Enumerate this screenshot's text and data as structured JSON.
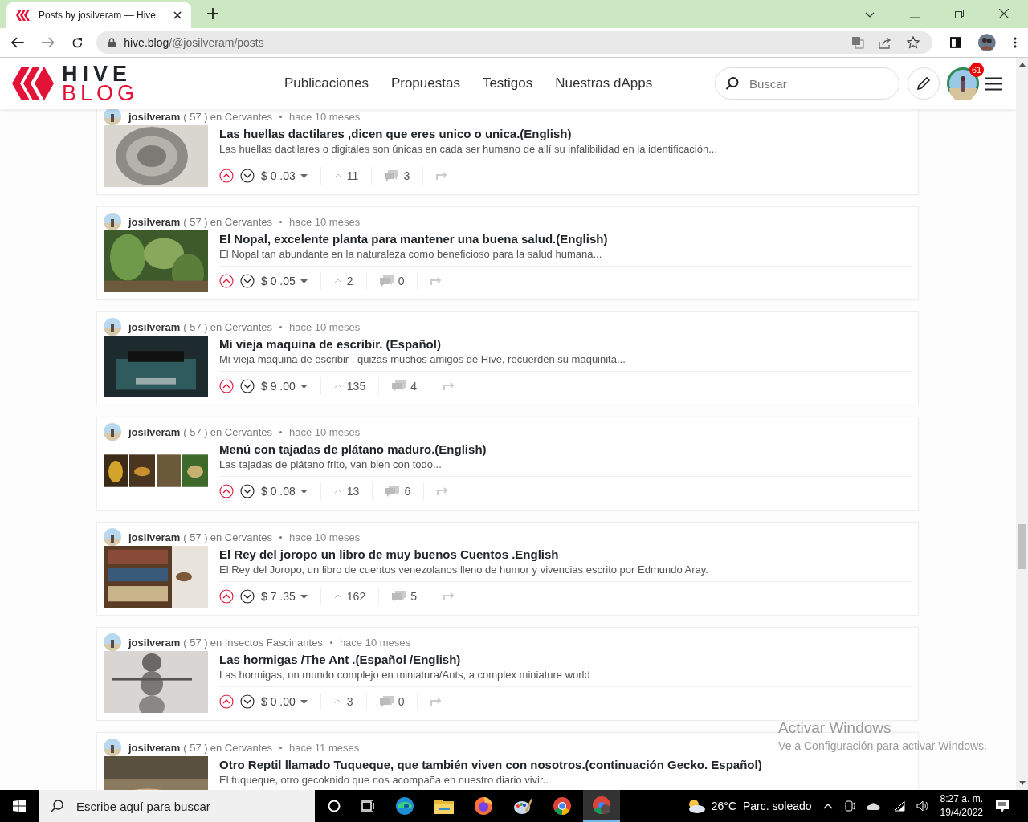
{
  "browser": {
    "tab_title": "Posts by josilveram — Hive",
    "url_host": "hive.blog",
    "url_path": "/@josilveram/posts"
  },
  "header": {
    "logo_top": "HIVE",
    "logo_bottom": "BLOG",
    "nav": [
      "Publicaciones",
      "Propuestas",
      "Testigos",
      "Nuestras dApps"
    ],
    "search": {
      "placeholder": "Buscar"
    },
    "notifications": "61"
  },
  "posts": [
    {
      "author": "josilveram",
      "reputation": "( 57 )",
      "community": "en Cervantes",
      "time": "hace 10 meses",
      "title": "Las huellas dactilares ,dicen que eres unico o unica.(English)",
      "excerpt": "Las huellas dactilares o digitales son únicas en cada ser humano de allí su infalibilidad en la identificación...",
      "payout": "$ 0 .03",
      "votes": "11",
      "comments": "3"
    },
    {
      "author": "josilveram",
      "reputation": "( 57 )",
      "community": "en Cervantes",
      "time": "hace 10 meses",
      "title": "El Nopal, excelente planta para mantener una buena salud.(English)",
      "excerpt": "El Nopal tan abundante en la naturaleza como beneficioso para la salud humana...",
      "payout": "$ 0 .05",
      "votes": "2",
      "comments": "0"
    },
    {
      "author": "josilveram",
      "reputation": "( 57 )",
      "community": "en Cervantes",
      "time": "hace 10 meses",
      "title": "Mi vieja maquina de escribir. (Español)",
      "excerpt": "Mi vieja maquina de escribir , quizas muchos amigos de Hive, recuerden su maquinita...",
      "payout": "$ 9 .00",
      "votes": "135",
      "comments": "4"
    },
    {
      "author": "josilveram",
      "reputation": "( 57 )",
      "community": "en Cervantes",
      "time": "hace 10 meses",
      "title": "Menú con tajadas de plátano maduro.(English)",
      "excerpt": "Las tajadas de plátano frito, van bien con todo...",
      "payout": "$ 0 .08",
      "votes": "13",
      "comments": "6"
    },
    {
      "author": "josilveram",
      "reputation": "( 57 )",
      "community": "en Cervantes",
      "time": "hace 10 meses",
      "title": "El Rey del joropo un libro de muy buenos Cuentos .English",
      "excerpt": "El Rey del Joropo, un libro de cuentos venezolanos lleno de humor y vivencias escrito por Edmundo Aray.",
      "payout": "$ 7 .35",
      "votes": "162",
      "comments": "5"
    },
    {
      "author": "josilveram",
      "reputation": "( 57 )",
      "community": "en Insectos Fascinantes",
      "time": "hace 10 meses",
      "title": "Las hormigas /The Ant .(Español /English)",
      "excerpt": "Las hormigas, un mundo complejo en miniatura/Ants, a complex miniature world",
      "payout": "$ 0 .00",
      "votes": "3",
      "comments": "0"
    },
    {
      "author": "josilveram",
      "reputation": "( 57 )",
      "community": "en Cervantes",
      "time": "hace 11 meses",
      "title": "Otro Reptil llamado Tuqueque, que también viven con nosotros.(continuación Gecko. Español)",
      "excerpt": "El tuqueque, otro gecoknido que nos acompaña en nuestro diario vivir.."
    }
  ],
  "activation": {
    "title": "Activar Windows",
    "subtitle": "Ve a Configuración para activar Windows."
  },
  "taskbar": {
    "search_placeholder": "Escribe aquí para buscar",
    "temperature": "26°C",
    "weather": "Parc. soleado",
    "time": "8:27 a. m.",
    "date": "19/4/2022"
  }
}
